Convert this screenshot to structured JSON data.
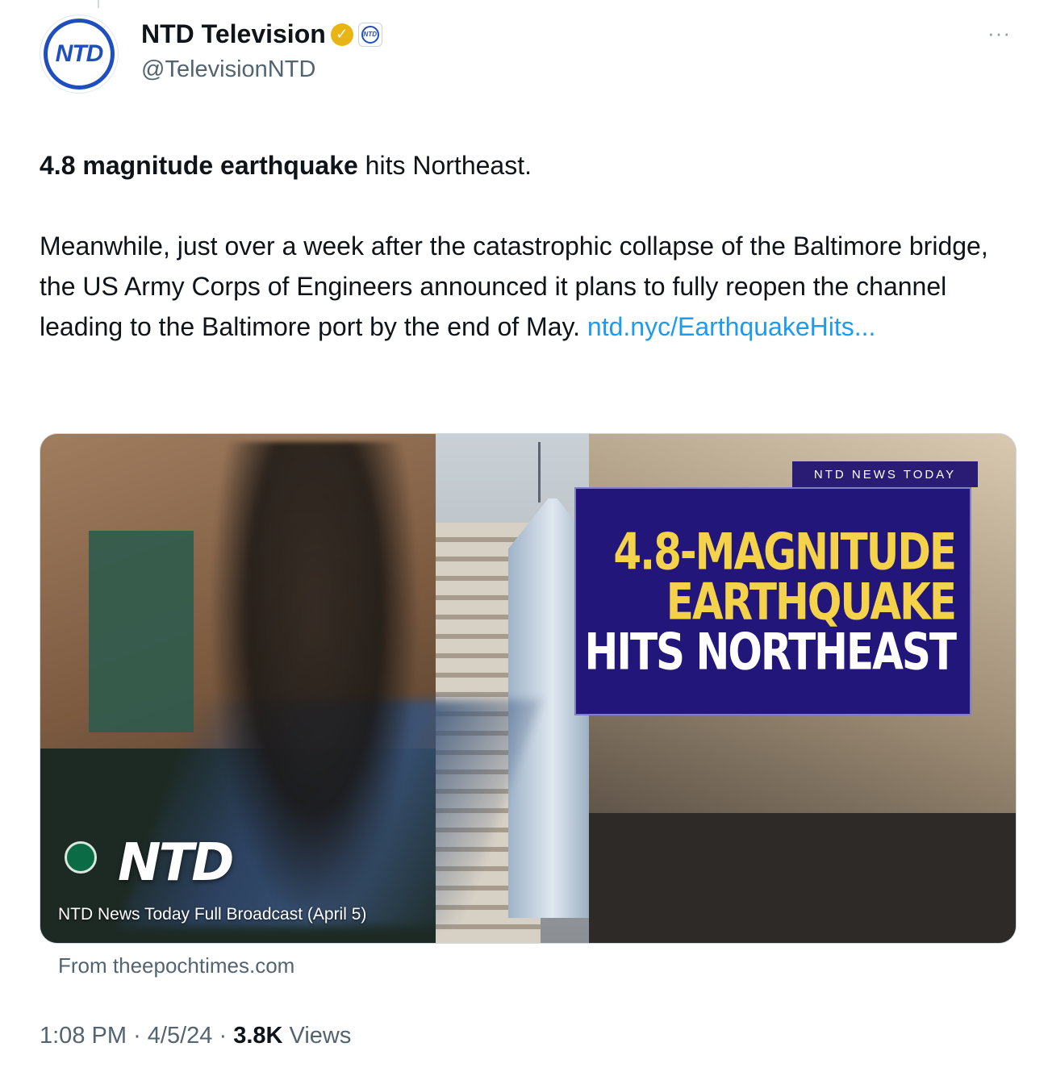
{
  "author": {
    "display_name": "NTD Television",
    "handle": "@TelevisionNTD",
    "avatar_text": "NTD",
    "affiliate_text": "NTD",
    "verified_color": "#e8b514"
  },
  "more_label": "···",
  "tweet": {
    "bold_text": "4.8 magnitude earthquake",
    "text_after_bold": " hits Northeast.",
    "paragraph2": "Meanwhile, just over a week after the catastrophic collapse of the Baltimore bridge, the US Army Corps of Engineers announced it plans to fully reopen the channel leading to the Baltimore port by the end of May. ",
    "link_text": "ntd.nyc/EarthquakeHits..."
  },
  "media": {
    "tag": "NTD NEWS TODAY",
    "headline_line1": "4.8-MAGNITUDE",
    "headline_line2": "EARTHQUAKE",
    "headline_line3": "HITS NORTHEAST",
    "logo_text": "NTD",
    "caption": "NTD News Today Full Broadcast (April 5)",
    "headline_accent_color": "#f4d24a",
    "headline_bg_color": "#22167a"
  },
  "source": "From theepochtimes.com",
  "meta": {
    "time": "1:08 PM",
    "date": "4/5/24",
    "views_count": "3.8K",
    "views_label": "Views"
  },
  "colors": {
    "link": "#1d9bf0",
    "secondary_text": "#536471",
    "primary_text": "#0f1419"
  }
}
